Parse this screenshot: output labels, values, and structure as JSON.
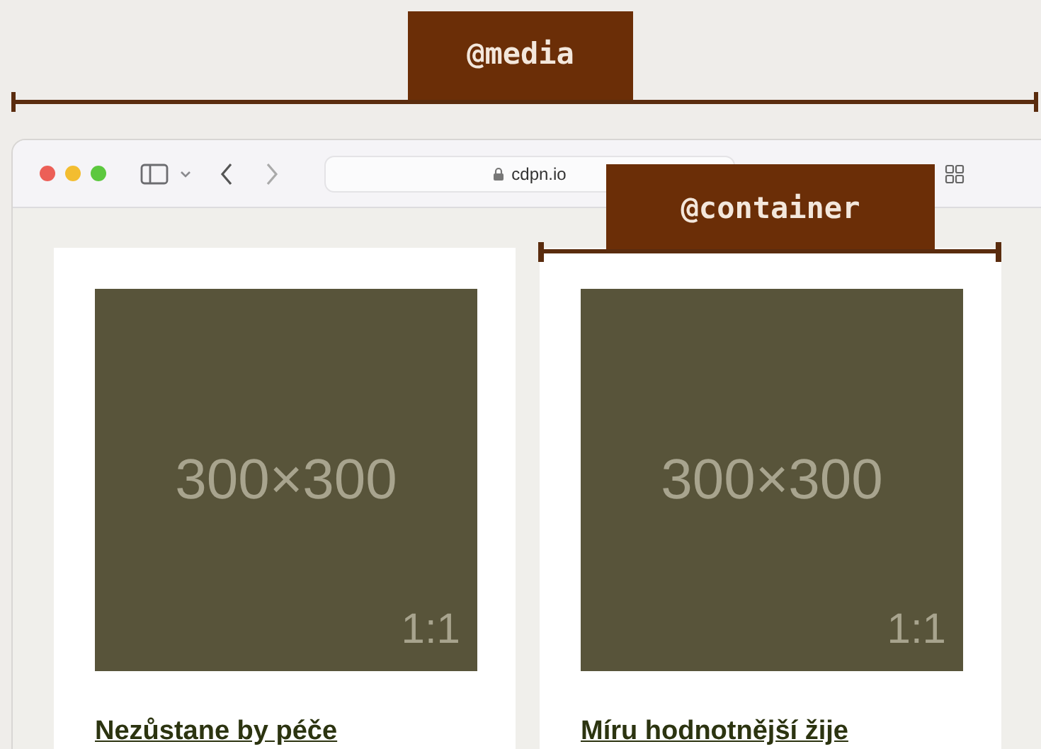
{
  "media_label": "@media",
  "container_label": "@container",
  "browser": {
    "url": "cdpn.io"
  },
  "cards": [
    {
      "image_text": "300×300",
      "ratio": "1:1",
      "title": "Nezůstane by péče"
    },
    {
      "image_text": "300×300",
      "ratio": "1:1",
      "title": "Míru hodnotnější žije"
    }
  ]
}
